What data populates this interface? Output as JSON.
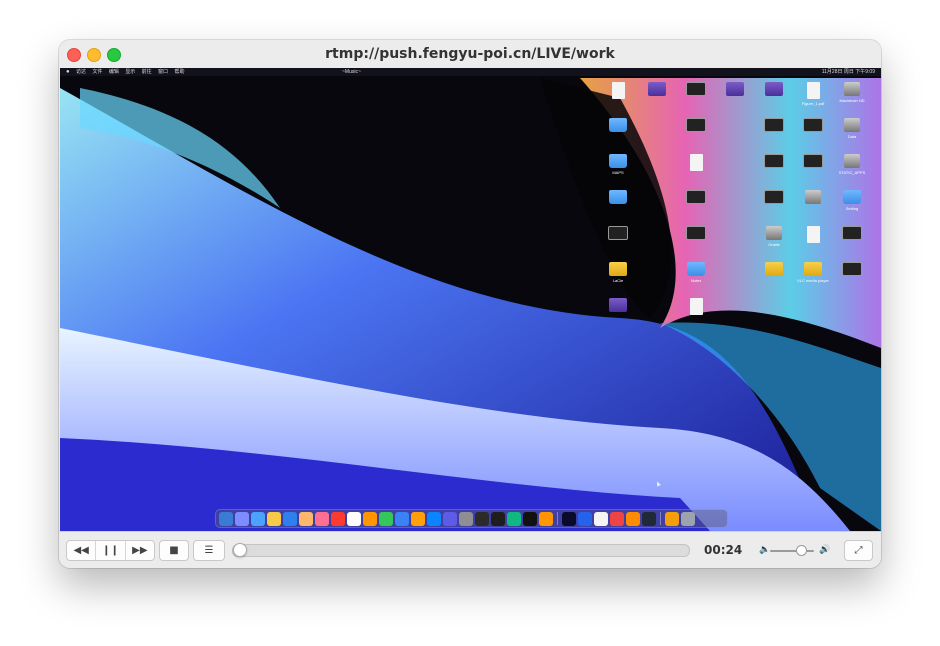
{
  "window": {
    "title": "rtmp://push.fengyu-poi.cn/LIVE/work"
  },
  "traffic_lights": {
    "close": "#fe5f57",
    "minimize": "#febc2e",
    "maximize": "#28c840"
  },
  "stream": {
    "menubar": {
      "left_items": [
        "",
        "访达",
        "文件",
        "编辑",
        "显示",
        "前往",
        "窗口",
        "帮助"
      ],
      "center": "~Music~",
      "right": "11月28日 周日 下午9:09"
    },
    "desktop_icons": [
      {
        "label": "",
        "kind": "doc"
      },
      {
        "label": "",
        "kind": "purple"
      },
      {
        "label": "",
        "kind": "img"
      },
      {
        "label": "",
        "kind": "purple"
      },
      {
        "label": "",
        "kind": "purple"
      },
      {
        "label": "Figure_1.pdf",
        "kind": "doc"
      },
      {
        "label": "Macintosh HD",
        "kind": "disk"
      },
      {
        "label": "",
        "kind": "folder"
      },
      {
        "label": "",
        "kind": "img"
      },
      {
        "label": "",
        "kind": "img"
      },
      {
        "label": "",
        "kind": "img"
      },
      {
        "label": "Data",
        "kind": "disk"
      },
      {
        "label": "MAPS",
        "kind": "folder"
      },
      {
        "label": "",
        "kind": "doc"
      },
      {
        "label": "",
        "kind": "img"
      },
      {
        "label": "",
        "kind": "img"
      },
      {
        "label": "STATIC_APPS",
        "kind": "disk"
      },
      {
        "label": "",
        "kind": "folder"
      },
      {
        "label": "",
        "kind": "img"
      },
      {
        "label": "",
        "kind": "img"
      },
      {
        "label": "",
        "kind": "disk"
      },
      {
        "label": "Setting",
        "kind": "folder"
      },
      {
        "label": "",
        "kind": "img"
      },
      {
        "label": "",
        "kind": "img"
      },
      {
        "label": "Onsite",
        "kind": "disk"
      },
      {
        "label": "",
        "kind": "doc"
      },
      {
        "label": "",
        "kind": "img"
      },
      {
        "label": "LaCie",
        "kind": "yellow"
      },
      {
        "label": "Notes",
        "kind": "folder"
      },
      {
        "label": "",
        "kind": "yellow"
      },
      {
        "label": "VLC media player",
        "kind": "yellow"
      },
      {
        "label": "",
        "kind": "img"
      },
      {
        "label": "",
        "kind": "purple"
      },
      {
        "label": "",
        "kind": "doc"
      }
    ],
    "dock_apps": [
      "#3a7bd5",
      "#7d8cff",
      "#4aa3ff",
      "#f7c948",
      "#2f80ed",
      "#ffb86b",
      "#ff6f91",
      "#ff3b30",
      "#ffffff",
      "#ff9500",
      "#34c759",
      "#3b82f6",
      "#ff9f0a",
      "#0a84ff",
      "#5e5ce6",
      "#8e8e93",
      "#2b2b2b",
      "#1e1e1e",
      "#10b981",
      "#111111",
      "#ff9500",
      "#0a0a2a",
      "#2563eb",
      "#f4f4f4",
      "#ef4444",
      "#ff8c00",
      "#1f2937",
      "#f59e0b",
      "#9ca3af"
    ]
  },
  "controls": {
    "rewind_icon": "rewind-icon",
    "pause_icon": "pause-icon",
    "fastforward_icon": "fast-forward-icon",
    "stop_icon": "stop-icon",
    "playlist_icon": "playlist-icon",
    "fullscreen_icon": "fullscreen-icon",
    "rewind_glyph": "◀◀",
    "pause_glyph": "❙❙",
    "forward_glyph": "▶▶",
    "stop_glyph": "■",
    "playlist_glyph": "☰",
    "fullscreen_glyph": "⤢",
    "vol_low_glyph": "🔈",
    "vol_high_glyph": "🔊",
    "time": "00:24",
    "progress": 0.0,
    "volume": 0.8
  }
}
